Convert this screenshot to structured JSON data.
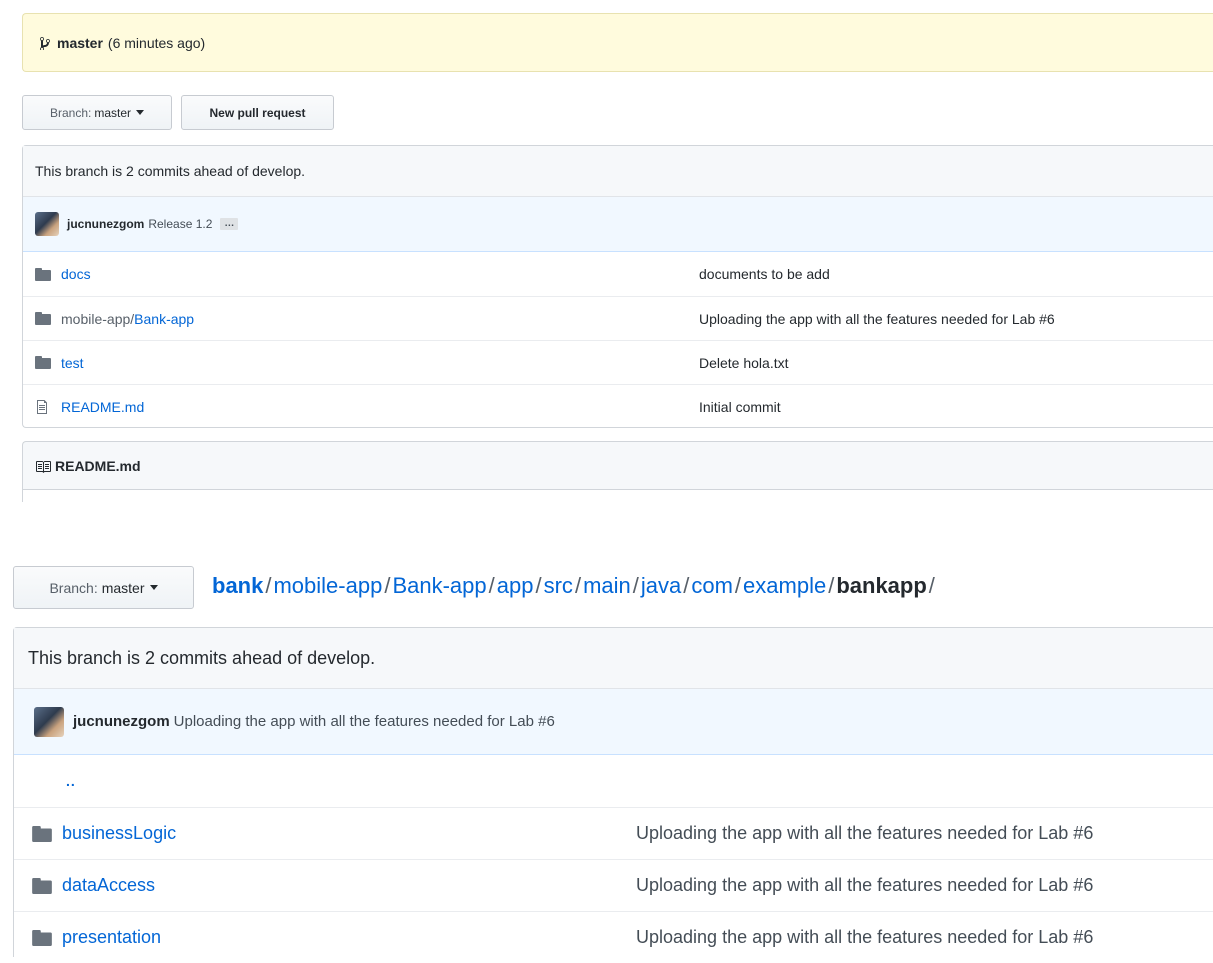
{
  "top": {
    "notice": {
      "branch": "master",
      "time": "(6 minutes ago)"
    },
    "branch_button": {
      "prefix": "Branch:",
      "value": "master"
    },
    "pull_request_button": "New pull request",
    "ahead_text": "This branch is 2 commits ahead of develop.",
    "commit": {
      "author": "jucnunezgom",
      "message": "Release 1.2",
      "ellipsis": "…"
    },
    "files": [
      {
        "type": "folder",
        "name": "docs",
        "message": "documents to be add"
      },
      {
        "type": "folder",
        "prefix": "mobile-app/",
        "name": "Bank-app",
        "message": "Uploading the app with all the features needed for Lab #6"
      },
      {
        "type": "folder",
        "name": "test",
        "message": "Delete hola.txt"
      },
      {
        "type": "file",
        "name": "README.md",
        "message": "Initial commit"
      }
    ],
    "readme_header": "README.md"
  },
  "bottom": {
    "branch_button": {
      "prefix": "Branch:",
      "value": "master"
    },
    "breadcrumb": [
      "bank",
      "mobile-app",
      "Bank-app",
      "app",
      "src",
      "main",
      "java",
      "com",
      "example",
      "bankapp"
    ],
    "breadcrumb_sep": "/",
    "ahead_text": "This branch is 2 commits ahead of develop.",
    "commit": {
      "author": "jucnunezgom",
      "message": "Uploading the app with all the features needed for Lab #6"
    },
    "updir": "..",
    "files": [
      {
        "type": "folder",
        "name": "businessLogic",
        "message": "Uploading the app with all the features needed for Lab #6"
      },
      {
        "type": "folder",
        "name": "dataAccess",
        "message": "Uploading the app with all the features needed for Lab #6"
      },
      {
        "type": "folder",
        "name": "presentation",
        "message": "Uploading the app with all the features needed for Lab #6"
      }
    ]
  },
  "colors": {
    "link": "#0366d6",
    "notice_bg": "#fffbdd",
    "commit_bg": "#f1f8ff",
    "folder_icon": "#79b8ff"
  },
  "icons": [
    "branch-icon",
    "folder-icon",
    "file-icon",
    "book-icon",
    "caret-down-icon",
    "avatar"
  ]
}
